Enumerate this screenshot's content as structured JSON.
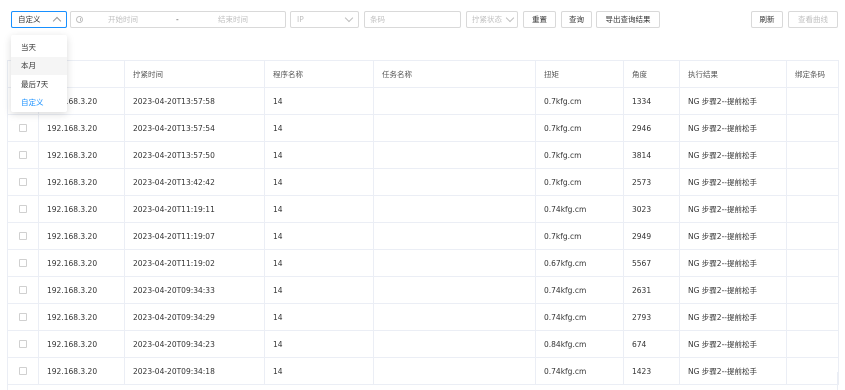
{
  "toolbar": {
    "range_select_value": "自定义",
    "start_time_placeholder": "开始时间",
    "range_separator": "-",
    "end_time_placeholder": "结束时间",
    "ip_placeholder": "IP",
    "barcode_placeholder": "条码",
    "status_placeholder": "拧紧状态",
    "reset_label": "重置",
    "query_label": "查询",
    "export_label": "导出查询结果",
    "refresh_label": "刷新",
    "curve_label": "查看曲线"
  },
  "dropdown": {
    "items": [
      "当天",
      "本月",
      "最后7天",
      "自定义"
    ],
    "selected_index": 3,
    "hover_index": 1
  },
  "table": {
    "headers": [
      "",
      "拧紧时间",
      "程序名称",
      "任务名称",
      "扭矩",
      "角度",
      "执行结果",
      "绑定条码"
    ],
    "rows": [
      [
        "192.168.3.20",
        "2023-04-20T13:57:58",
        "14",
        "",
        "0.7kfg.cm",
        "1334",
        "NG 步骤2--提前松手",
        ""
      ],
      [
        "192.168.3.20",
        "2023-04-20T13:57:54",
        "14",
        "",
        "0.7kfg.cm",
        "2946",
        "NG 步骤2--提前松手",
        ""
      ],
      [
        "192.168.3.20",
        "2023-04-20T13:57:50",
        "14",
        "",
        "0.7kfg.cm",
        "3814",
        "NG 步骤2--提前松手",
        ""
      ],
      [
        "192.168.3.20",
        "2023-04-20T13:42:42",
        "14",
        "",
        "0.7kfg.cm",
        "2573",
        "NG 步骤2--提前松手",
        ""
      ],
      [
        "192.168.3.20",
        "2023-04-20T11:19:11",
        "14",
        "",
        "0.74kfg.cm",
        "3023",
        "NG 步骤2--提前松手",
        ""
      ],
      [
        "192.168.3.20",
        "2023-04-20T11:19:07",
        "14",
        "",
        "0.7kfg.cm",
        "2949",
        "NG 步骤2--提前松手",
        ""
      ],
      [
        "192.168.3.20",
        "2023-04-20T11:19:02",
        "14",
        "",
        "0.67kfg.cm",
        "5567",
        "NG 步骤2--提前松手",
        ""
      ],
      [
        "192.168.3.20",
        "2023-04-20T09:34:33",
        "14",
        "",
        "0.74kfg.cm",
        "2631",
        "NG 步骤2--提前松手",
        ""
      ],
      [
        "192.168.3.20",
        "2023-04-20T09:34:29",
        "14",
        "",
        "0.74kfg.cm",
        "2793",
        "NG 步骤2--提前松手",
        ""
      ],
      [
        "192.168.3.20",
        "2023-04-20T09:34:23",
        "14",
        "",
        "0.84kfg.cm",
        "674",
        "NG 步骤2--提前松手",
        ""
      ],
      [
        "192.168.3.20",
        "2023-04-20T09:34:18",
        "14",
        "",
        "0.74kfg.cm",
        "1423",
        "NG 步骤2--提前松手",
        ""
      ]
    ]
  },
  "colors": {
    "accent": "#1890ff",
    "border": "#d9d9d9",
    "grid": "#ebeef5"
  }
}
